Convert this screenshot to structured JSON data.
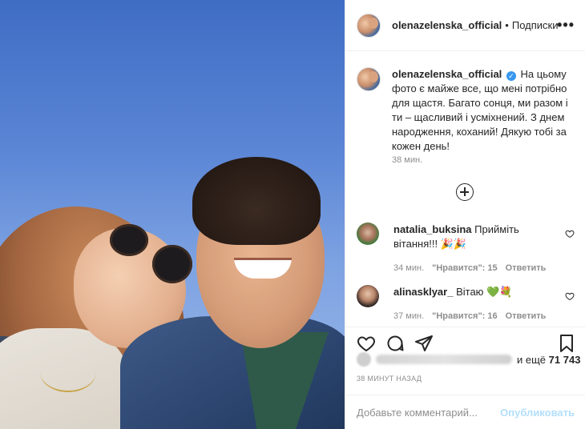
{
  "post": {
    "username": "olenazelenska_official",
    "follow_status": "Подписки",
    "more_icon": "more-options-icon",
    "caption_text": "На цьому фото є майже все, що мені потрібно для щастя. Багато сонця, ми разом і ти – щасливий і усміхнений. З днем народження, коханий! Дякую тобі за кожен день!",
    "caption_time": "38 мин.",
    "verified_icon": "verified-badge-icon",
    "likes_prefix": "и ещё",
    "likes_count": "71 743",
    "posted_ago": "38 МИНУТ НАЗАД"
  },
  "comments": [
    {
      "username": "natalia_buksina",
      "text": "Прийміть вітання!!! 🎉🎉",
      "time": "34 мин.",
      "likes": "\"Нравится\": 15",
      "reply": "Ответить"
    },
    {
      "username": "alinasklyar_",
      "text": "Вітаю 💚💐",
      "time": "37 мин.",
      "likes": "\"Нравится\": 16",
      "reply": "Ответить"
    }
  ],
  "add_comment": {
    "placeholder": "Добавьте комментарий...",
    "publish_label": "Опубликовать"
  },
  "colors": {
    "accent": "#3897f0",
    "publish_disabled": "#b2dffc",
    "muted_text": "#8e8e8e"
  }
}
